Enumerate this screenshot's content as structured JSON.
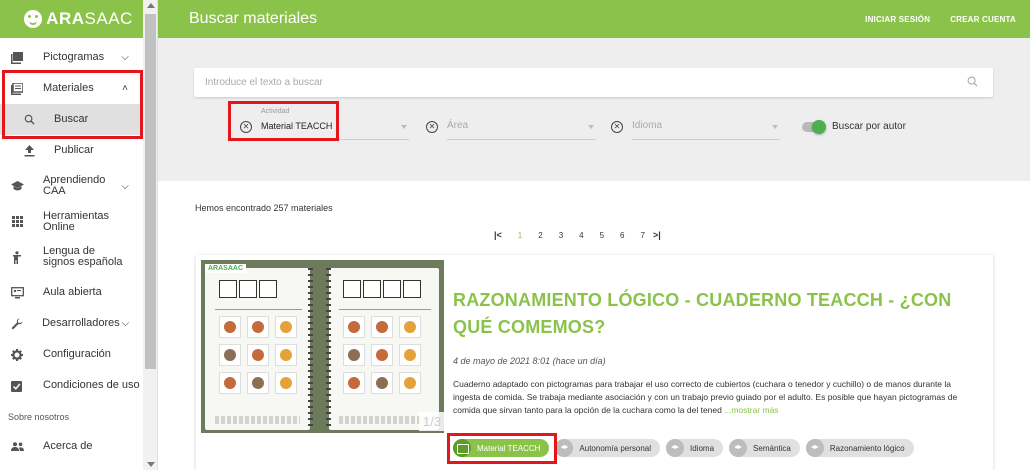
{
  "brand": {
    "name_bold": "ARA",
    "name_rest": "SAAC"
  },
  "header": {
    "title": "Buscar materiales",
    "login_label": "INICIAR SESIÓN",
    "signup_label": "CREAR CUENTA"
  },
  "sidebar": {
    "items": [
      {
        "label": "Pictogramas",
        "icon": "image-icon"
      },
      {
        "label": "Materiales",
        "icon": "library-icon"
      },
      {
        "label": "Buscar",
        "icon": "search-icon"
      },
      {
        "label": "Publicar",
        "icon": "upload-icon"
      },
      {
        "label": "Aprendiendo CAA",
        "icon": "school-icon"
      },
      {
        "label": "Herramientas Online",
        "icon": "apps-icon"
      },
      {
        "label": "Lengua de signos española",
        "icon": "sign-language-icon"
      },
      {
        "label": "Aula abierta",
        "icon": "classroom-icon"
      },
      {
        "label": "Desarrolladores",
        "icon": "wrench-icon"
      },
      {
        "label": "Configuración",
        "icon": "gear-icon"
      },
      {
        "label": "Condiciones de uso",
        "icon": "checkbox-icon"
      }
    ],
    "section_label": "Sobre nosotros",
    "about_item": {
      "label": "Acerca de",
      "icon": "people-icon"
    }
  },
  "search": {
    "placeholder": "Introduce el texto a buscar",
    "value": "",
    "filters": {
      "activity": {
        "label": "Actividad",
        "value": "Material TEACCH"
      },
      "area": {
        "placeholder": "Área"
      },
      "language": {
        "placeholder": "Idioma"
      }
    },
    "author_toggle_label": "Buscar por autor",
    "author_toggle_on": true
  },
  "results": {
    "count_text": "Hemos encontrado 257 materiales",
    "pages": [
      "1",
      "2",
      "3",
      "4",
      "5",
      "6",
      "7"
    ],
    "current_page": "1"
  },
  "material": {
    "title": "RAZONAMIENTO LÓGICO - CUADERNO TEACCH - ¿CON QUÉ COMEMOS?",
    "date": "4 de mayo de 2021 8:01 (hace un día)",
    "description": "Cuaderno adaptado con pictogramas para trabajar el uso correcto de cubiertos (cuchara o tenedor y cuchillo) o de manos durante la ingesta de comida. Se trabaja mediante asociación y con un trabajo previo guiado por el adulto. Es posible que hayan pictogramas de comida que sirvan tanto para la opción de la cuchara como la del tened",
    "more_label": "...mostrar más",
    "image_counter": "1/3",
    "image_badge": "ARASAAC",
    "tags": [
      {
        "label": "Material TEACCH",
        "active": true
      },
      {
        "label": "Autonomía personal",
        "active": false
      },
      {
        "label": "Idioma",
        "active": false
      },
      {
        "label": "Semántica",
        "active": false
      },
      {
        "label": "Razonamiento lógico",
        "active": false
      }
    ]
  },
  "colors": {
    "brand_green": "#8bc34a",
    "highlight_red": "#e3161b",
    "toggle_green": "#4caf50"
  }
}
